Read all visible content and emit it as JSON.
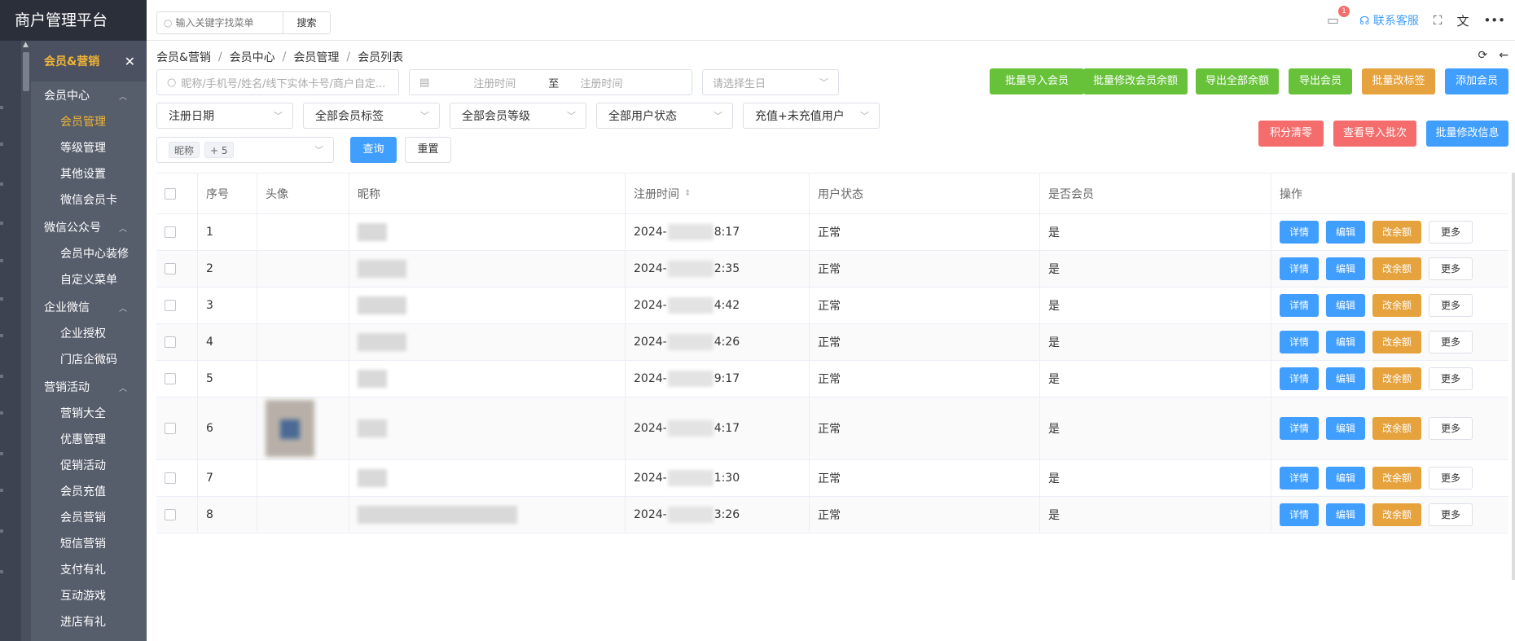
{
  "brand": {
    "title": "商户管理平台"
  },
  "sidebar": {
    "header": {
      "title": "会员&营销",
      "close_icon": "close-icon"
    },
    "groups": [
      {
        "label": "会员中心",
        "items": [
          {
            "label": "会员管理",
            "active": true
          },
          {
            "label": "等级管理"
          },
          {
            "label": "其他设置"
          },
          {
            "label": "微信会员卡"
          }
        ]
      },
      {
        "label": "微信公众号",
        "items": [
          {
            "label": "会员中心装修"
          },
          {
            "label": "自定义菜单"
          }
        ]
      },
      {
        "label": "企业微信",
        "items": [
          {
            "label": "企业授权"
          },
          {
            "label": "门店企微码"
          }
        ]
      },
      {
        "label": "营销活动",
        "items": [
          {
            "label": "营销大全"
          },
          {
            "label": "优惠管理"
          },
          {
            "label": "促销活动"
          },
          {
            "label": "会员充值"
          },
          {
            "label": "会员营销"
          },
          {
            "label": "短信营销"
          },
          {
            "label": "支付有礼"
          },
          {
            "label": "互动游戏"
          },
          {
            "label": "进店有礼"
          }
        ]
      }
    ]
  },
  "topbar": {
    "search_placeholder": "输入关键字找菜单",
    "search_button": "搜索",
    "message_badge": "1",
    "service_label": "联系客服",
    "colors": {
      "accent": "#409eff",
      "badge": "#f56c6c"
    }
  },
  "breadcrumb": [
    "会员&营销",
    "会员中心",
    "会员管理",
    "会员列表"
  ],
  "filters": {
    "keyword_placeholder": "昵称/手机号/姓名/线下实体卡号/商户自定...",
    "reg_start_placeholder": "注册时间",
    "range_sep": "至",
    "reg_end_placeholder": "注册时间",
    "birthday_placeholder": "请选择生日",
    "reg_date": "注册日期",
    "member_tag": "全部会员标签",
    "member_level": "全部会员等级",
    "user_status": "全部用户状态",
    "recharge": "充值+未充值用户",
    "field_tag": "昵称",
    "field_more": "+ 5",
    "query": "查询",
    "reset": "重置"
  },
  "actions": {
    "import_members": "批量导入会员",
    "batch_balance": "批量修改会员余额",
    "export_all_balance": "导出全部余额",
    "export_members": "导出会员",
    "batch_tag": "批量改标签",
    "add_member": "添加会员",
    "clear_points": "积分清零",
    "view_import": "查看导入批次",
    "batch_info": "批量修改信息"
  },
  "table": {
    "columns": [
      "序号",
      "头像",
      "昵称",
      "注册时间",
      "用户状态",
      "是否会员",
      "操作"
    ],
    "rows": [
      {
        "no": "1",
        "reg": "2024-",
        "reg_tail": "8:17",
        "status": "正常",
        "member": "是"
      },
      {
        "no": "2",
        "reg": "2024-",
        "reg_tail": "2:35",
        "status": "正常",
        "member": "是"
      },
      {
        "no": "3",
        "reg": "2024-",
        "reg_tail": "4:42",
        "status": "正常",
        "member": "是"
      },
      {
        "no": "4",
        "reg": "2024-",
        "reg_tail": "4:26",
        "status": "正常",
        "member": "是"
      },
      {
        "no": "5",
        "reg": "2024-",
        "reg_tail": "9:17",
        "status": "正常",
        "member": "是"
      },
      {
        "no": "6",
        "reg": "2024-",
        "reg_tail": "4:17",
        "status": "正常",
        "member": "是"
      },
      {
        "no": "7",
        "reg": "2024-",
        "reg_tail": "1:30",
        "status": "正常",
        "member": "是"
      },
      {
        "no": "8",
        "reg": "2024-",
        "reg_tail": "3:26",
        "status": "正常",
        "member": "是"
      }
    ],
    "row_actions": {
      "detail": "详情",
      "edit": "编辑",
      "balance": "改余额",
      "more": "更多"
    }
  }
}
